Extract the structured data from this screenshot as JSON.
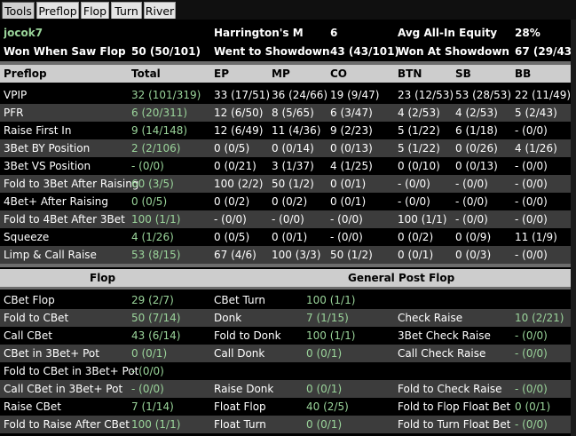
{
  "tabs": [
    "Tools",
    "Preflop",
    "Flop",
    "Turn",
    "River"
  ],
  "player": {
    "name": "jocok7",
    "harrington_label": "Harrington's M",
    "harrington_value": "6",
    "allin_label": "Avg All-In Equity",
    "allin_value": "28%",
    "wwsf_label": "Won When Saw Flop",
    "wwsf_value": "50 (50/101)",
    "wtsd_label": "Went to Showdown",
    "wtsd_value": "43 (43/101)",
    "wsd_label": "Won At Showdown",
    "wsd_value": "67 (29/43)"
  },
  "preflop": {
    "headers": [
      "Preflop",
      "Total",
      "EP",
      "MP",
      "CO",
      "BTN",
      "SB",
      "BB"
    ],
    "rows": [
      [
        "VPIP",
        "32 (101/319)",
        "33 (17/51)",
        "36 (24/66)",
        "19 (9/47)",
        "23 (12/53)",
        "53 (28/53)",
        "22 (11/49)"
      ],
      [
        "PFR",
        "6 (20/311)",
        "12 (6/50)",
        "8 (5/65)",
        "6 (3/47)",
        "4 (2/53)",
        "4 (2/53)",
        "5 (2/43)"
      ],
      [
        "Raise First In",
        "9 (14/148)",
        "12 (6/49)",
        "11 (4/36)",
        "9 (2/23)",
        "5 (1/22)",
        "6 (1/18)",
        "- (0/0)"
      ],
      [
        "3Bet BY Position",
        "2 (2/106)",
        "0 (0/5)",
        "0 (0/14)",
        "0 (0/13)",
        "5 (1/22)",
        "0 (0/26)",
        "4 (1/26)"
      ],
      [
        "3Bet VS Position",
        "- (0/0)",
        "0 (0/21)",
        "3 (1/37)",
        "4 (1/25)",
        "0 (0/10)",
        "0 (0/13)",
        "- (0/0)"
      ],
      [
        "Fold to 3Bet After Raising",
        "60 (3/5)",
        "100 (2/2)",
        "50 (1/2)",
        "0 (0/1)",
        "- (0/0)",
        "- (0/0)",
        "- (0/0)"
      ],
      [
        "4Bet+ After Raising",
        "0 (0/5)",
        "0 (0/2)",
        "0 (0/2)",
        "0 (0/1)",
        "- (0/0)",
        "- (0/0)",
        "- (0/0)"
      ],
      [
        "Fold to 4Bet After 3Bet",
        "100 (1/1)",
        "- (0/0)",
        "- (0/0)",
        "- (0/0)",
        "100 (1/1)",
        "- (0/0)",
        "- (0/0)"
      ],
      [
        "Squeeze",
        "4 (1/26)",
        "0 (0/5)",
        "0 (0/1)",
        "- (0/0)",
        "0 (0/2)",
        "0 (0/9)",
        "11 (1/9)"
      ],
      [
        "Limp & Call Raise",
        "53 (8/15)",
        "67 (4/6)",
        "100 (3/3)",
        "50 (1/2)",
        "0 (0/1)",
        "0 (0/3)",
        "- (0/0)"
      ]
    ]
  },
  "post": {
    "flop_header": "Flop",
    "general_header": "General Post Flop",
    "rows": [
      [
        "CBet Flop",
        "29 (2/7)",
        "CBet Turn",
        "100 (1/1)",
        "",
        ""
      ],
      [
        "Fold to CBet",
        "50 (7/14)",
        "Donk",
        "7 (1/15)",
        "Check Raise",
        "10 (2/21)"
      ],
      [
        "Call CBet",
        "43 (6/14)",
        "Fold to Donk",
        "100 (1/1)",
        "3Bet Check Raise",
        "- (0/0)"
      ],
      [
        "CBet in 3Bet+ Pot",
        "0 (0/1)",
        "Call Donk",
        "0 (0/1)",
        "Call Check Raise",
        "- (0/0)"
      ],
      [
        "Fold to CBet in 3Bet+ Pot",
        "- (0/0)",
        "",
        "",
        "",
        ""
      ],
      [
        "Call CBet in 3Bet+ Pot",
        "- (0/0)",
        "Raise Donk",
        "0 (0/1)",
        "Fold to Check Raise",
        "- (0/0)"
      ],
      [
        "Raise CBet",
        "7 (1/14)",
        "Float Flop",
        "40 (2/5)",
        "Fold to Flop Float Bet",
        "0 (0/1)"
      ],
      [
        "Fold to Raise After CBet",
        "100 (1/1)",
        "Float Turn",
        "0 (0/1)",
        "Fold to Turn Float Bet",
        "- (0/0)"
      ]
    ]
  },
  "colors": {
    "green": "#9ad49a",
    "alt_row": "#3c3c3c",
    "section_bar": "#cdcdcd"
  }
}
